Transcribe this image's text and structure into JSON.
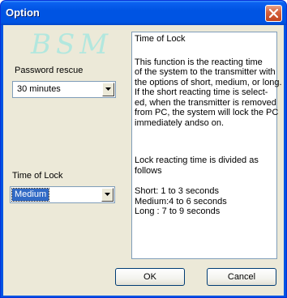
{
  "window": {
    "title": "Option",
    "watermark": "BSM"
  },
  "password_rescue": {
    "label": "Password rescue",
    "value": "30 minutes"
  },
  "time_of_lock": {
    "label": "Time of Lock",
    "value": "Medium"
  },
  "info": {
    "title": "Time of Lock",
    "body_lines": [
      "This function is the reacting time",
      "of the system to the transmitter with",
      "the options of short, medium, or long.",
      "If the short reacting time is select-",
      "ed, when the transmitter is removed",
      "from PC, the system will lock the PC",
      "immediately andso on."
    ],
    "divided_lines": [
      "Lock reacting time is divided as",
      "follows"
    ],
    "timing_lines": [
      "Short: 1 to 3 seconds",
      "Medium:4 to 6 seconds",
      "Long : 7 to 9 seconds"
    ]
  },
  "buttons": {
    "ok": "OK",
    "cancel": "Cancel"
  },
  "colors": {
    "title_bar": "#0054e3",
    "dialog_face": "#ece9d8",
    "selection": "#316ac5",
    "watermark": "#9fe7e0"
  },
  "icons": {
    "close": "close-icon",
    "dropdown": "chevron-down-icon"
  }
}
